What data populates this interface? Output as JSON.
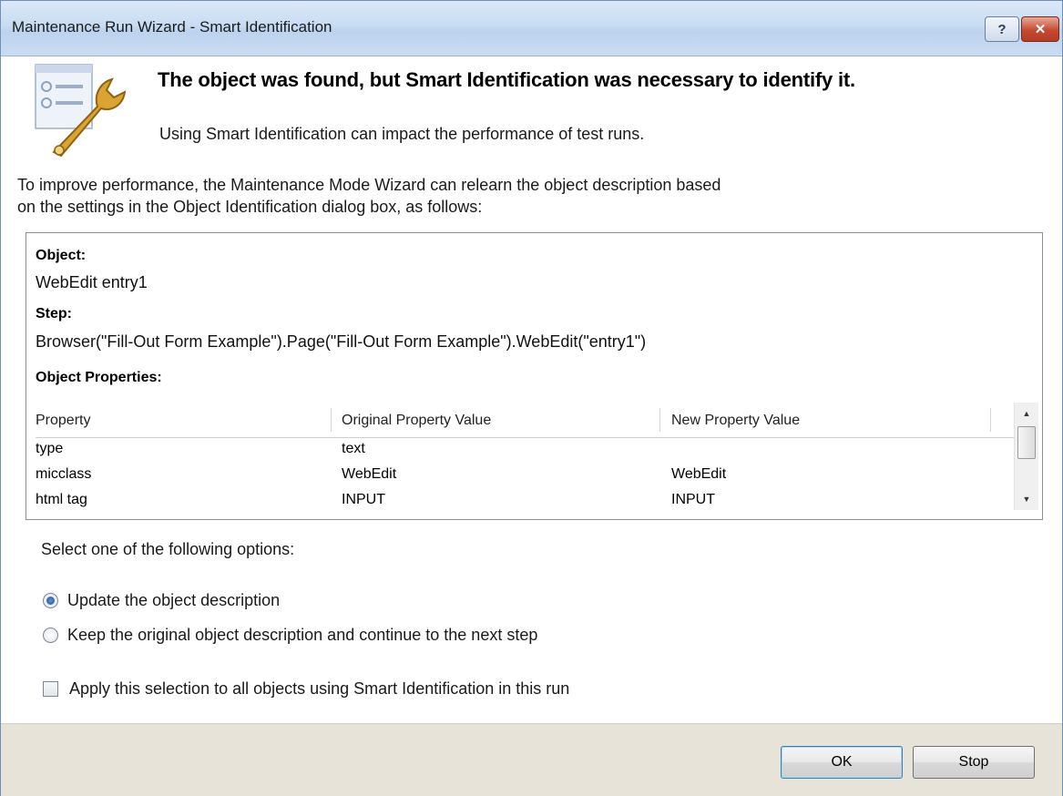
{
  "window": {
    "title": "Maintenance Run Wizard - Smart Identification",
    "help_label": "?",
    "close_label": "✕"
  },
  "header": {
    "title": "The object was found, but Smart Identification was necessary to identify it.",
    "subtitle": "Using Smart Identification can impact the performance of test runs."
  },
  "intro": {
    "line1": "To improve performance, the Maintenance Mode Wizard can relearn the object description based",
    "line2": "on the settings in the Object Identification dialog box, as follows:"
  },
  "details": {
    "object_label": "Object:",
    "object_value": "WebEdit entry1",
    "step_label": "Step:",
    "step_value": "Browser(\"Fill-Out Form Example\").Page(\"Fill-Out Form Example\").WebEdit(\"entry1\")",
    "properties_label": "Object Properties:",
    "columns": [
      "Property",
      "Original Property Value",
      "New Property Value"
    ],
    "rows": [
      {
        "property": "type",
        "original": "text",
        "new": ""
      },
      {
        "property": "micclass",
        "original": "WebEdit",
        "new": "WebEdit"
      },
      {
        "property": "html tag",
        "original": "INPUT",
        "new": "INPUT"
      }
    ]
  },
  "options": {
    "label": "Select one of the following options:",
    "radio_update": "Update the object description",
    "radio_keep": "Keep the original object description and continue to the next step",
    "selected": "update",
    "apply_all": "Apply this selection to all objects using Smart Identification in this run",
    "apply_all_checked": false
  },
  "buttons": {
    "ok": "OK",
    "stop": "Stop"
  },
  "colors": {
    "titlebar": "#c8dcf2",
    "footer": "#e7e3d9",
    "accent": "#3c7fb1"
  }
}
